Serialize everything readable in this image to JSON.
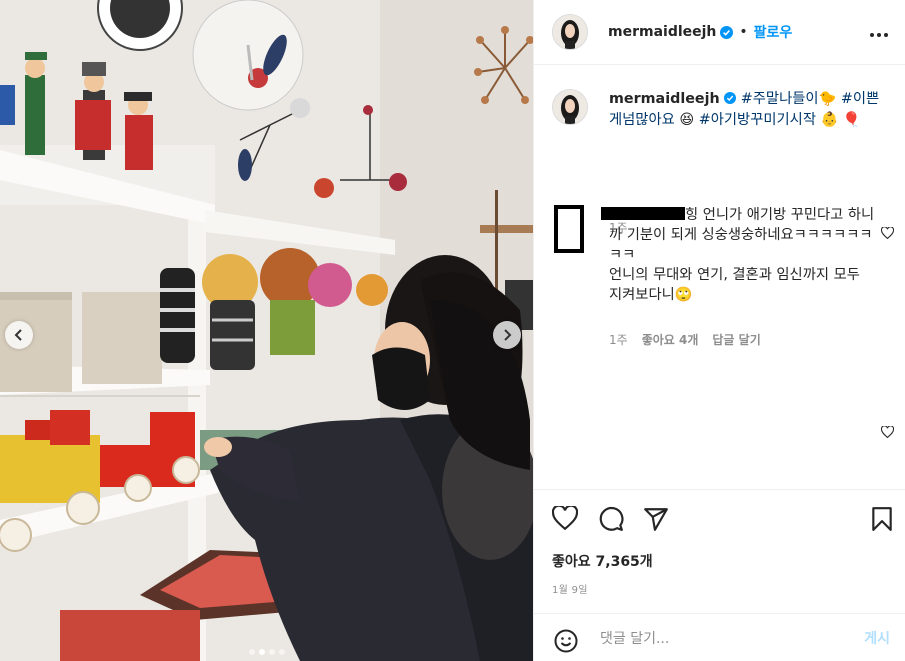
{
  "post": {
    "username": "mermaidleejh",
    "follow_label": "팔로우",
    "bullet": "•",
    "verified": true,
    "photo": {
      "description": "Woman in black mask browsing toy shelves in a shop",
      "carousel_dots": 4,
      "active_dot": 1
    }
  },
  "caption": {
    "username": "mermaidleejh",
    "text_before": " ",
    "tag1": "#주말나들이",
    "emoji1": "🐤",
    "tag2": "#이쁜게넘많아요",
    "emoji2": "😆",
    "tag3": "#아기방꾸미기시작",
    "emoji3": "👶",
    "emoji4": "🎈",
    "time": "1주"
  },
  "comment": {
    "name_suffix": "힝",
    "text": " 언니가 애기방 꾸민다고 하니까 기분이 되게 싱숭생숭하네요ㅋㅋㅋㅋㅋㅋㅋㅋ",
    "text2": "언니의 무대와 연기, 결혼과 임신까지 모두 지켜보다니🙄",
    "time": "1주",
    "likes": "좋아요 4개",
    "reply": "답글 달기"
  },
  "actions": {
    "likes": "좋아요 7,365개",
    "date": "1월 9일"
  },
  "add_comment": {
    "placeholder": "댓글 달기...",
    "post_label": "게시"
  },
  "colors": {
    "accent": "#0095f6",
    "tag": "#00376b",
    "muted": "#8e8e8e",
    "post_disabled": "#b2dffc"
  }
}
